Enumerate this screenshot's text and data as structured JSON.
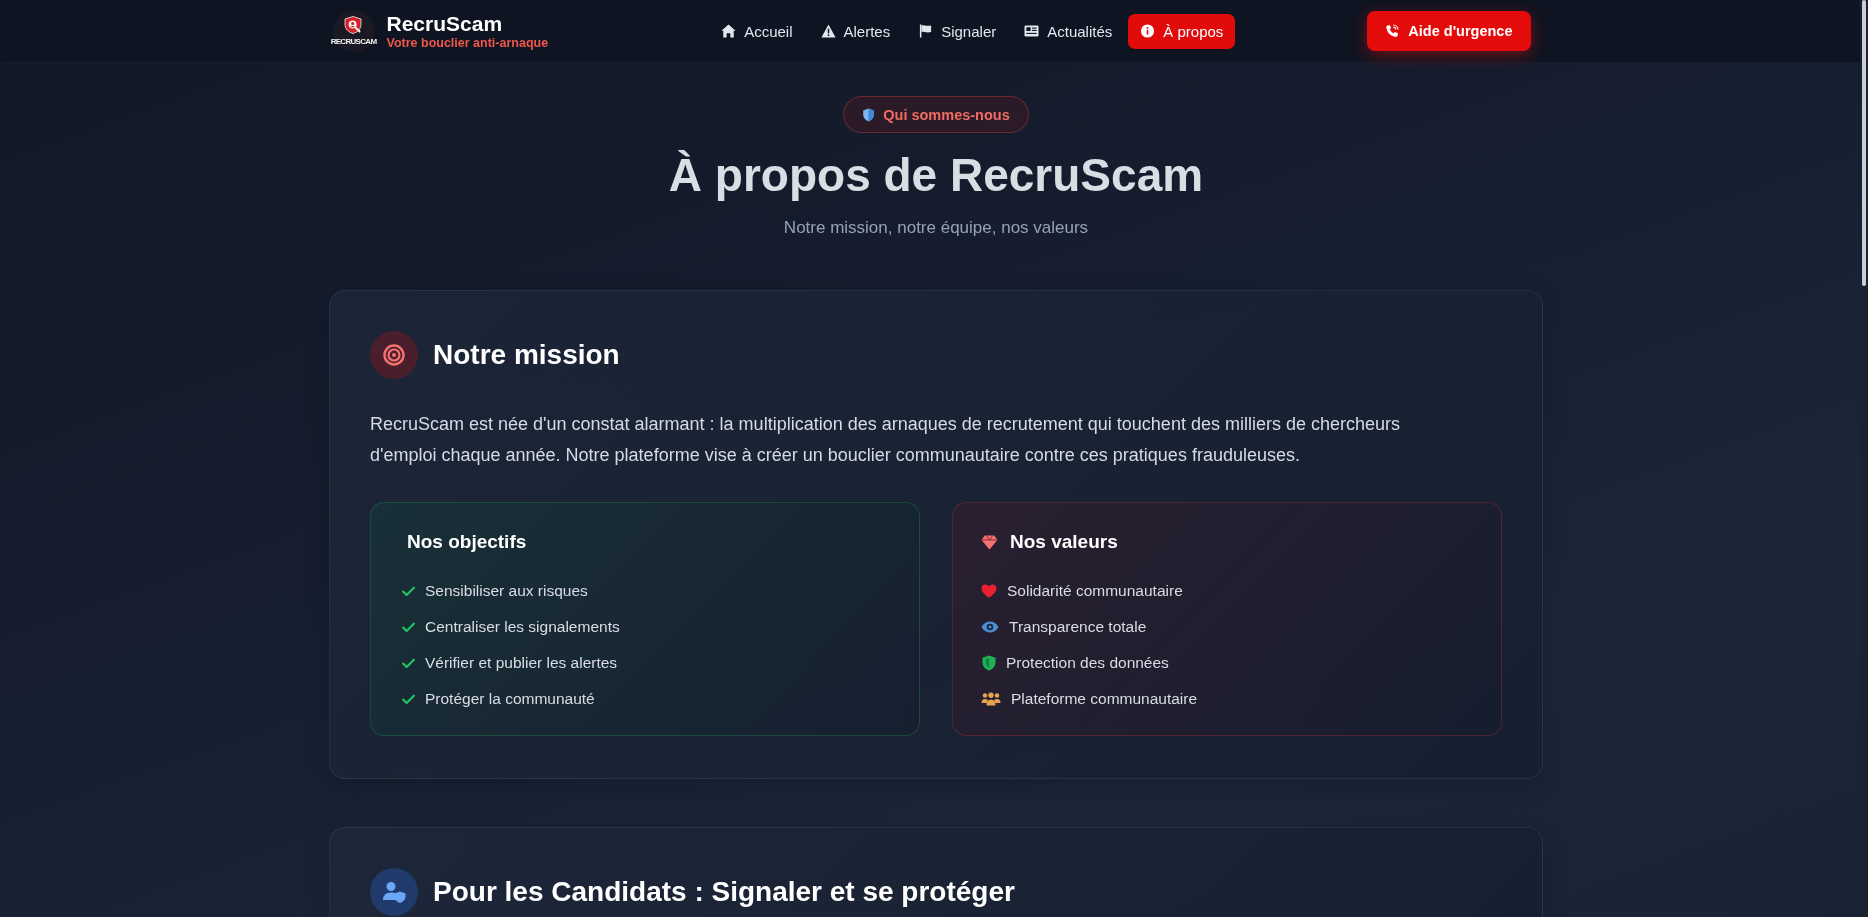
{
  "header": {
    "logo": {
      "emblem_text": "RECRUSCAM",
      "name": "RecruScam",
      "tagline": "Votre bouclier anti-arnaque"
    },
    "nav": [
      {
        "label": "Accueil",
        "selected": false
      },
      {
        "label": "Alertes",
        "selected": false
      },
      {
        "label": "Signaler",
        "selected": false
      },
      {
        "label": "Actualités",
        "selected": false
      },
      {
        "label": "À propos",
        "selected": true
      }
    ],
    "emergency_button": "Aide d'urgence"
  },
  "hero": {
    "badge": "Qui sommes-nous",
    "title": "À propos de RecruScam",
    "subtitle": "Notre mission, notre équipe, nos valeurs"
  },
  "sections": [
    {
      "kind": "mission",
      "title": "Notre mission",
      "paragraph": "RecruScam est née d'un constat alarmant : la multiplication des arnaques de recrutement qui touchent des milliers de chercheurs d'emploi chaque année. Notre plateforme vise à créer un bouclier communautaire contre ces pratiques frauduleuses.",
      "panels": [
        {
          "kind": "checklist",
          "title": "Nos objectifs",
          "items": [
            "Sensibiliser aux risques",
            "Centraliser les signalements",
            "Vérifier et publier les alertes",
            "Protéger la communauté"
          ]
        },
        {
          "kind": "iconlist",
          "title": "Nos valeurs",
          "items": [
            "Solidarité communautaire",
            "Transparence totale",
            "Protection des données",
            "Plateforme communautaire"
          ]
        }
      ]
    },
    {
      "kind": "candidates",
      "title": "Pour les Candidats : Signaler et se protéger"
    }
  ]
}
